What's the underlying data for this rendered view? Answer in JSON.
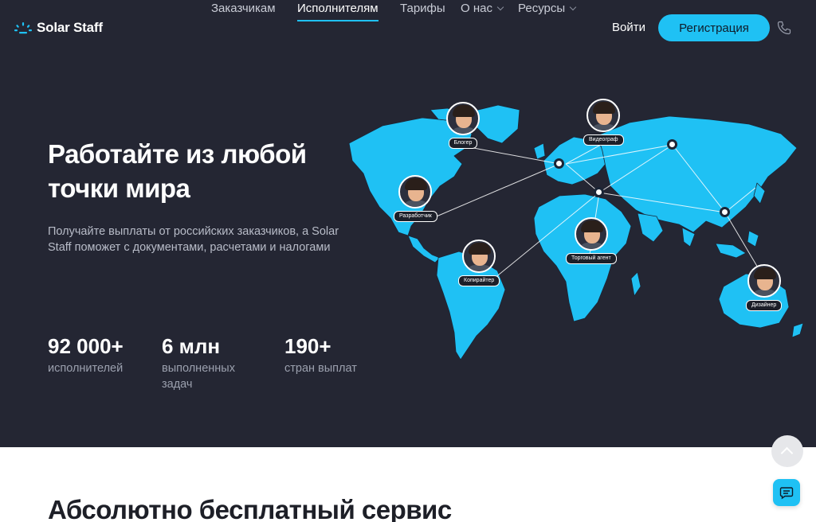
{
  "header": {
    "logo_text": "Solar Staff",
    "nav": [
      {
        "label": "Заказчикам",
        "active": false,
        "dropdown": false
      },
      {
        "label": "Исполнителям",
        "active": true,
        "dropdown": false
      },
      {
        "label": "Тарифы",
        "active": false,
        "dropdown": false
      },
      {
        "label": "О нас",
        "active": false,
        "dropdown": true
      },
      {
        "label": "Ресурсы",
        "active": false,
        "dropdown": true
      }
    ],
    "login_label": "Войти",
    "register_label": "Регистрация",
    "phone_icon": "phone-icon"
  },
  "hero": {
    "title": "Работайте из любой точки мира",
    "subtitle": "Получайте выплаты от российских заказчиков, а Solar Staff поможет с документами, расчетами и налогами",
    "stats": [
      {
        "value": "92 000+",
        "label": "исполнителей"
      },
      {
        "value": "6 млн",
        "label": "выполненных задач"
      },
      {
        "value": "190+",
        "label": "стран выплат"
      }
    ]
  },
  "map": {
    "roles": [
      "Блогер",
      "Видеограф",
      "Разработчик",
      "Копирайтер",
      "Торговый агент",
      "Дизайнер"
    ]
  },
  "section": {
    "title": "Абсолютно бесплатный сервис"
  },
  "colors": {
    "background": "#242633",
    "accent": "#1fc1f4",
    "text": "#ffffff"
  }
}
